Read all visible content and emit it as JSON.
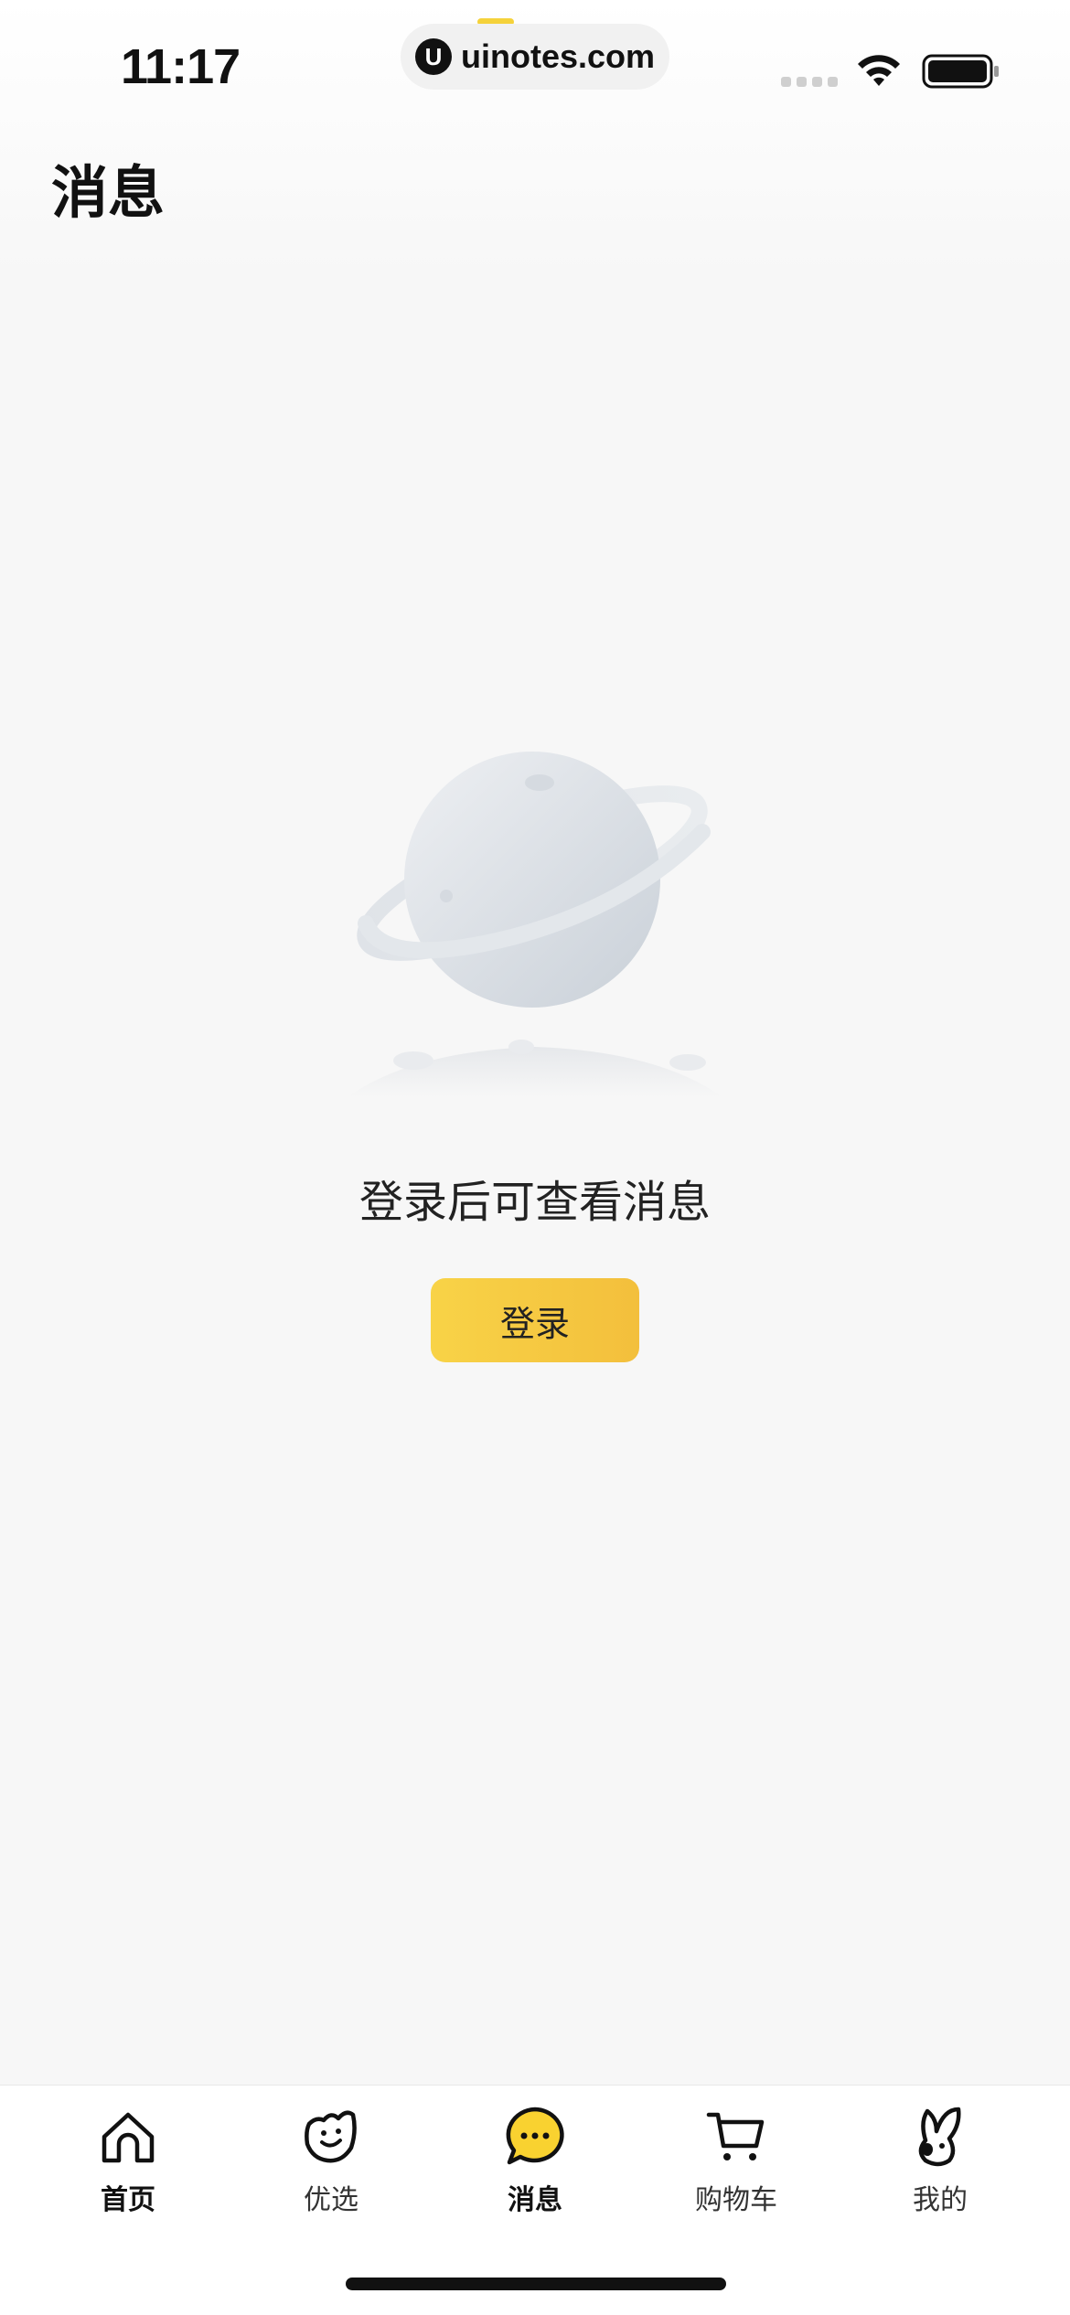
{
  "status_bar": {
    "time": "11:17",
    "url": "uinotes.com",
    "url_logo_letter": "U",
    "icons": [
      "signal-icon",
      "wifi-icon",
      "battery-icon"
    ]
  },
  "header": {
    "title": "消息"
  },
  "empty_state": {
    "illustration": "planet-icon",
    "message": "登录后可查看消息",
    "login_label": "登录"
  },
  "tab_bar": {
    "active_index": 2,
    "items": [
      {
        "label": "首页",
        "icon": "home-icon"
      },
      {
        "label": "优选",
        "icon": "bag-face-icon"
      },
      {
        "label": "消息",
        "icon": "chat-bubble-icon"
      },
      {
        "label": "购物车",
        "icon": "cart-icon"
      },
      {
        "label": "我的",
        "icon": "rabbit-icon"
      }
    ]
  },
  "colors": {
    "accent": "#f5c93e",
    "background": "#f7f7f7",
    "text": "#111111"
  }
}
